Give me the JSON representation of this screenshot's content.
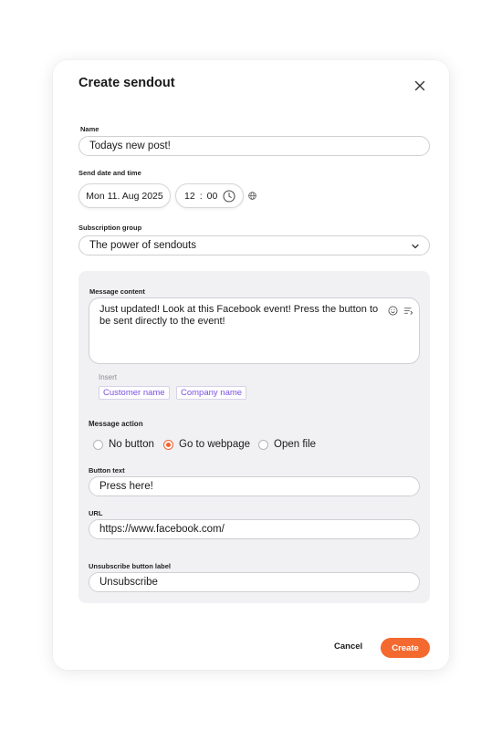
{
  "dialog": {
    "title": "Create sendout"
  },
  "name_field": {
    "label": "Name",
    "value": "Todays new post!"
  },
  "send_date": {
    "label": "Send date and time",
    "date": "Mon 11. Aug 2025",
    "hour": "12",
    "separator": ":",
    "minute": "00"
  },
  "subscription_group": {
    "label": "Subscription group",
    "selected": "The power of sendouts"
  },
  "message_content": {
    "label": "Message content",
    "text": "Just updated! Look at this Facebook event! Press the button to be sent directly to the event!",
    "insert_label": "Insert",
    "insert_chips": [
      "Customer name",
      "Company name"
    ]
  },
  "message_action": {
    "label": "Message action",
    "options": [
      "No button",
      "Go to webpage",
      "Open file"
    ],
    "selected": "Go to webpage"
  },
  "button_text": {
    "label": "Button text",
    "value": "Press here!"
  },
  "url": {
    "label": "URL",
    "value": "https://www.facebook.com/"
  },
  "unsubscribe": {
    "label": "Unsubscribe button label",
    "value": "Unsubscribe"
  },
  "footer": {
    "cancel_label": "Cancel",
    "create_label": "Create"
  },
  "colors": {
    "accent": "#f4692f",
    "chip_text": "#7b4fe0",
    "panel_bg": "#f1f1f4"
  },
  "icons": [
    "close-icon",
    "clock-icon",
    "globe-icon",
    "chevron-down-icon",
    "emoji-icon",
    "text-format-icon"
  ]
}
